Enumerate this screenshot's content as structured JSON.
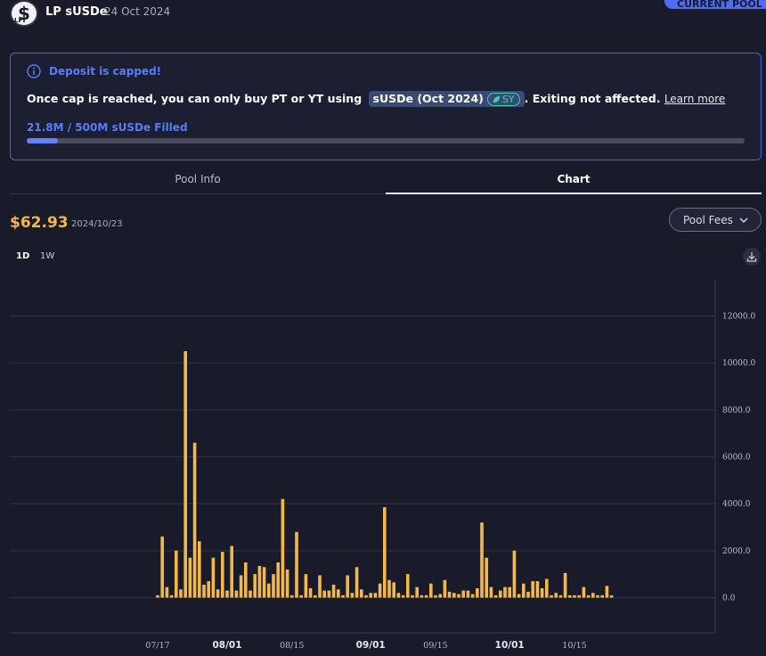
{
  "pool": {
    "name": "LP sUSDe",
    "date": "24 Oct 2024",
    "current_pool_label": "CURRENT POOL"
  },
  "cap": {
    "title": "Deposit is capped!",
    "message_prefix": "Once cap is reached, you can only buy PT or YT using",
    "token_label": "sUSDe (Oct 2024)",
    "sy_label": "SY",
    "message_suffix": ". Exiting not affected.",
    "learn_more": "Learn more",
    "fill_text": "21.8M / 500M sUSDe Filled",
    "fill_fraction": 0.0436,
    "accent_color": "#5b7cf7"
  },
  "tabs": [
    {
      "label": "Pool Info",
      "active": false
    },
    {
      "label": "Chart",
      "active": true
    }
  ],
  "summary": {
    "price": "$62.93",
    "date": "2024/10/23"
  },
  "metric_select": {
    "selected": "Pool Fees"
  },
  "timeframes": [
    {
      "label": "1D",
      "active": true
    },
    {
      "label": "1W",
      "active": false
    }
  ],
  "icons": [
    "pool-logo-icon",
    "info-icon",
    "leaf-icon",
    "chevron-down-icon",
    "download-icon"
  ],
  "chart_data": {
    "type": "bar",
    "series_color": "#f2b94a",
    "ylim": [
      -1500,
      13500
    ],
    "y_ticks": [
      0,
      2000,
      4000,
      6000,
      8000,
      10000,
      12000
    ],
    "y_tick_labels": [
      "0.0",
      "2000.0",
      "4000.0",
      "6000.0",
      "8000.0",
      "10000.0",
      "12000.0"
    ],
    "x_tick_labels": [
      {
        "label": "07/17",
        "day": 17,
        "bold": false
      },
      {
        "label": "08/01",
        "day": 32,
        "bold": true
      },
      {
        "label": "08/15",
        "day": 46,
        "bold": false
      },
      {
        "label": "09/01",
        "day": 63,
        "bold": true
      },
      {
        "label": "09/15",
        "day": 77,
        "bold": false
      },
      {
        "label": "10/01",
        "day": 93,
        "bold": true
      },
      {
        "label": "10/15",
        "day": 107,
        "bold": false
      }
    ],
    "x_first_date": "07/17",
    "values": [
      100,
      2600,
      450,
      100,
      2000,
      350,
      10500,
      1700,
      6600,
      2400,
      550,
      700,
      1700,
      350,
      1950,
      300,
      2200,
      300,
      950,
      1500,
      300,
      1000,
      1350,
      1300,
      600,
      1000,
      1500,
      4200,
      1200,
      100,
      2800,
      100,
      1000,
      400,
      100,
      950,
      300,
      300,
      550,
      350,
      100,
      950,
      200,
      1300,
      350,
      100,
      200,
      200,
      600,
      3850,
      750,
      650,
      200,
      100,
      1000,
      100,
      450,
      100,
      100,
      600,
      100,
      150,
      750,
      250,
      200,
      150,
      300,
      300,
      150,
      400,
      3200,
      1700,
      450,
      100,
      300,
      450,
      450,
      2000,
      150,
      600,
      250,
      700,
      700,
      400,
      800,
      100,
      200,
      100,
      1050,
      100,
      100,
      100,
      450,
      100,
      200,
      100,
      100,
      500,
      100
    ]
  }
}
